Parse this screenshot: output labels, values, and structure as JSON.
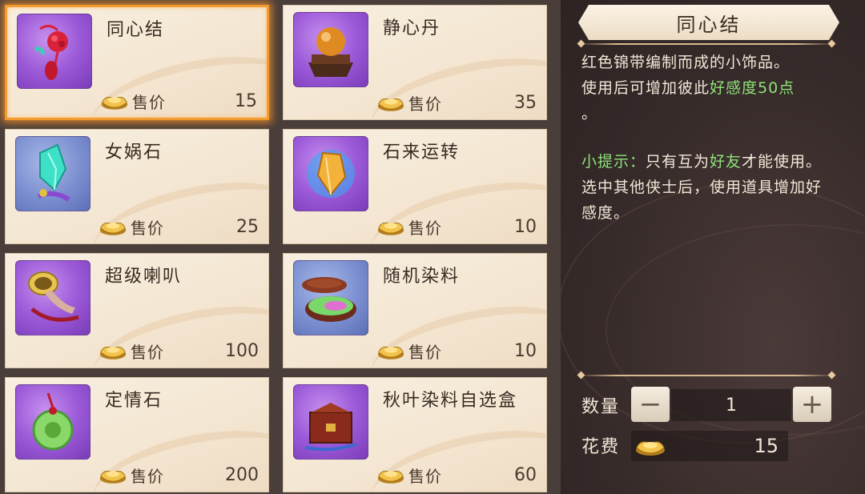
{
  "items": [
    {
      "name": "同心结",
      "price_label": "售价",
      "price": "15",
      "icon": "chinese-knot-icon",
      "bg": "purple",
      "selected": true
    },
    {
      "name": "静心丹",
      "price_label": "售价",
      "price": "35",
      "icon": "pill-box-icon",
      "bg": "purple",
      "selected": false
    },
    {
      "name": "女娲石",
      "price_label": "售价",
      "price": "25",
      "icon": "crystal-icon",
      "bg": "blue",
      "selected": false
    },
    {
      "name": "石来运转",
      "price_label": "售价",
      "price": "10",
      "icon": "gem-icon",
      "bg": "purple",
      "selected": false
    },
    {
      "name": "超级喇叭",
      "price_label": "售价",
      "price": "100",
      "icon": "horn-icon",
      "bg": "purple",
      "selected": false
    },
    {
      "name": "随机染料",
      "price_label": "售价",
      "price": "10",
      "icon": "dye-box-icon",
      "bg": "blue",
      "selected": false
    },
    {
      "name": "定情石",
      "price_label": "售价",
      "price": "200",
      "icon": "jade-pendant-icon",
      "bg": "purple",
      "selected": false
    },
    {
      "name": "秋叶染料自选盒",
      "price_label": "售价",
      "price": "60",
      "icon": "chest-icon",
      "bg": "purple",
      "selected": false
    }
  ],
  "detail": {
    "title": "同心结",
    "desc_line1": "红色锦带编制而成的小饰品。",
    "desc_line2_pre": "使用后可增加彼此",
    "desc_line2_green": "好感度50点",
    "desc_line3": "。",
    "tip_label": "小提示：",
    "tip_pre": "只有互为",
    "tip_green": "好友",
    "tip_post": "才能使用。选中其他侠士后，使用道具增加好感度。"
  },
  "purchase": {
    "qty_label": "数量",
    "qty_value": "1",
    "minus": "−",
    "plus": "+",
    "cost_label": "花费",
    "cost_value": "15"
  },
  "colors": {
    "selected_border": "#f39a2e",
    "highlight_green": "#8fe27a",
    "panel_bg": "#352a29"
  }
}
